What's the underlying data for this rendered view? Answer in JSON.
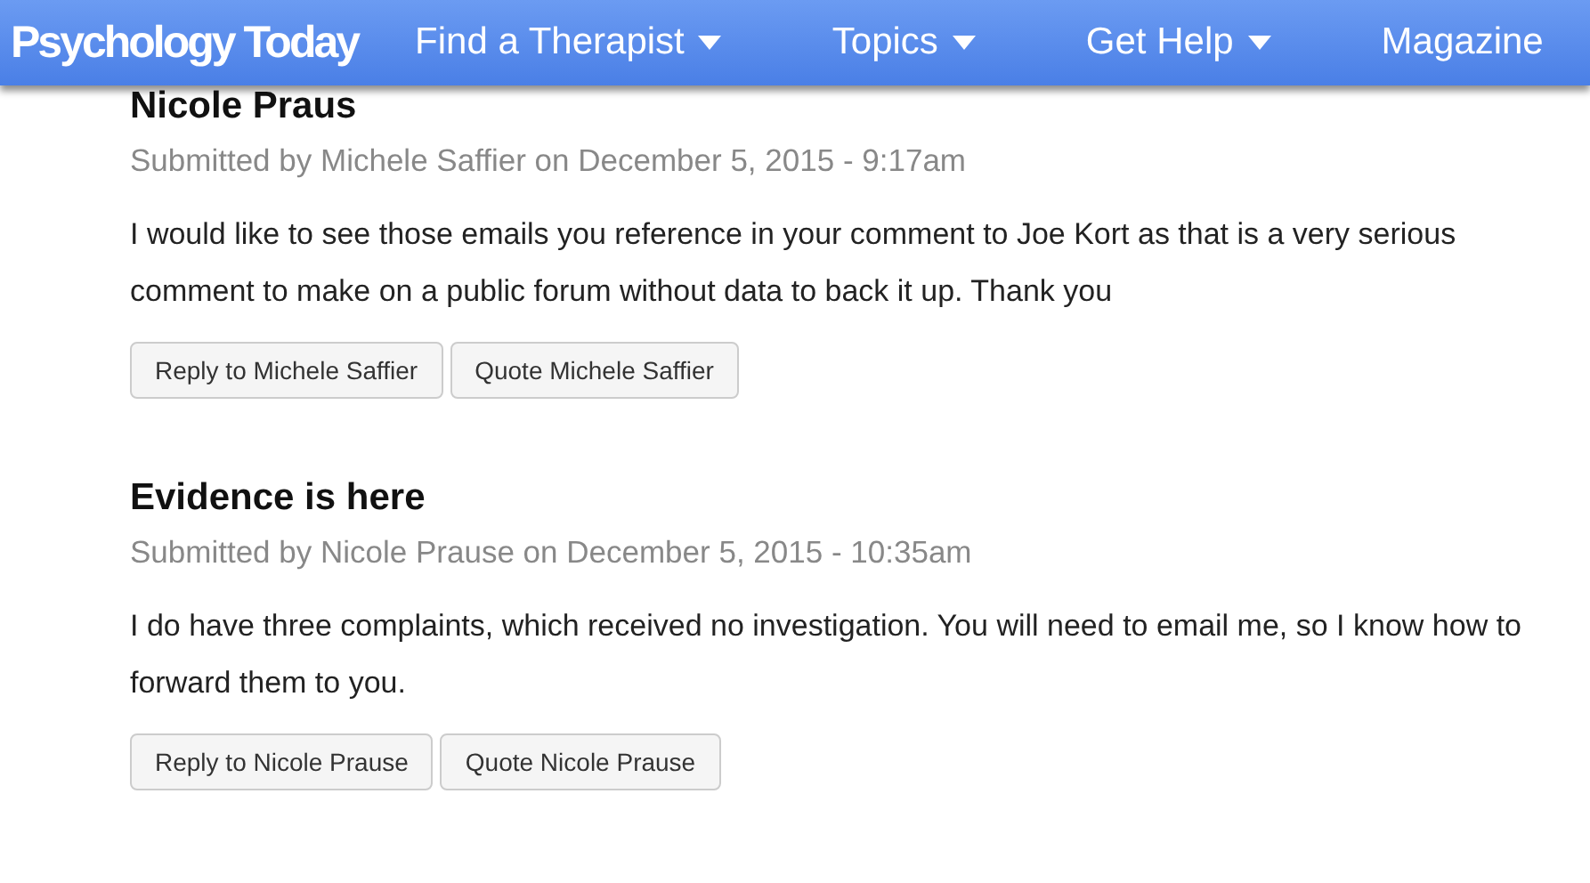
{
  "header": {
    "logo": "Psychology Today",
    "nav": [
      {
        "label": "Find a Therapist",
        "dropdown": true
      },
      {
        "label": "Topics",
        "dropdown": true
      },
      {
        "label": "Get Help",
        "dropdown": true
      },
      {
        "label": "Magazine",
        "dropdown": false
      }
    ]
  },
  "comments": [
    {
      "title": "Nicole Praus",
      "submitted": "Submitted by Michele Saffier on December 5, 2015 - 9:17am",
      "body": "I would like to see those emails you reference in your comment to Joe Kort as that is a very serious comment to make on a public forum without data to back it up. Thank you",
      "buttons": [
        "Reply to Michele Saffier",
        "Quote Michele Saffier"
      ]
    },
    {
      "title": "Evidence is here",
      "submitted": "Submitted by Nicole Prause on December 5, 2015 - 10:35am",
      "body": "I do have three complaints, which received no investigation. You will need to email me, so I know how to forward them to you.",
      "buttons": [
        "Reply to Nicole Prause",
        "Quote Nicole Prause"
      ]
    }
  ]
}
